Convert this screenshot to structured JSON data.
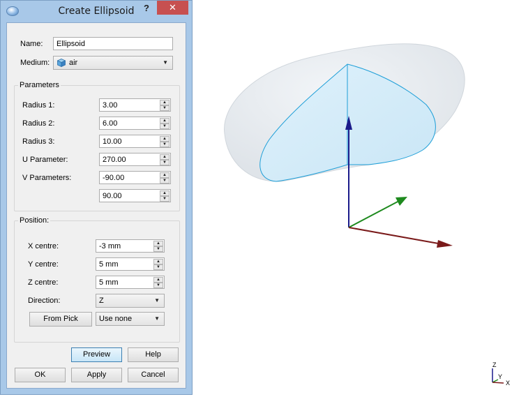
{
  "dialog": {
    "title": "Create Ellipsoid",
    "help_glyph": "?",
    "close_glyph": "✕"
  },
  "form": {
    "name_label": "Name:",
    "name_value": "Ellipsoid",
    "medium_label": "Medium:",
    "medium_value": "air"
  },
  "parameters": {
    "group_title": "Parameters",
    "radius1_label": "Radius 1:",
    "radius1_value": "3.00",
    "radius2_label": "Radius 2:",
    "radius2_value": "6.00",
    "radius3_label": "Radius 3:",
    "radius3_value": "10.00",
    "u_label": "U Parameter:",
    "u_value": "270.00",
    "v_label": "V Parameters:",
    "v_value_1": "-90.00",
    "v_value_2": "90.00"
  },
  "position": {
    "group_title": "Position:",
    "x_label": "X centre:",
    "x_value": "-3 mm",
    "y_label": "Y centre:",
    "y_value": "5 mm",
    "z_label": "Z centre:",
    "z_value": "5 mm",
    "direction_label": "Direction:",
    "direction_value": "Z",
    "from_pick_label": "From Pick",
    "use_value": "Use none"
  },
  "buttons": {
    "preview": "Preview",
    "help": "Help",
    "ok": "OK",
    "apply": "Apply",
    "cancel": "Cancel"
  },
  "mini_axes": {
    "z": "Z",
    "y": "Y",
    "x": "X"
  },
  "colors": {
    "ellipsoid_fill": "#e3e8ec",
    "cut_surface": "#d3ecf8",
    "cut_outline": "#1e9fd8",
    "axis_z": "#1b1b8a",
    "axis_y": "#1e8a1e",
    "axis_x": "#7a1a1a"
  }
}
